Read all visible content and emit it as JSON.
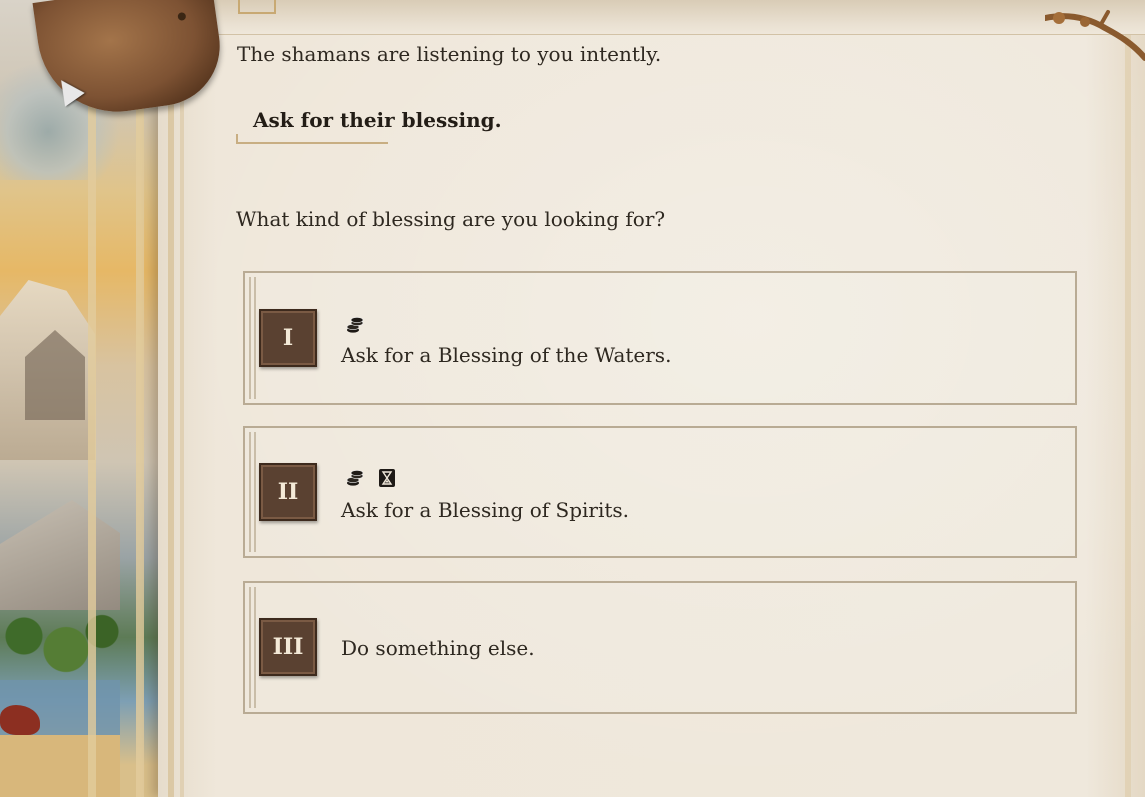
{
  "dialog": {
    "intro_text": "The shamans are listening to you intently.",
    "previous_choice": "Ask for their blessing.",
    "question": "What kind of blessing are you looking for?"
  },
  "options": [
    {
      "numeral": "I",
      "icons": [
        "coins-icon"
      ],
      "text": "Ask for a Blessing of the Waters."
    },
    {
      "numeral": "II",
      "icons": [
        "coins-icon",
        "hourglass-icon"
      ],
      "text": "Ask for a Blessing of Spirits."
    },
    {
      "numeral": "III",
      "icons": [],
      "text": "Do something else."
    }
  ],
  "colors": {
    "parchment": "#efe7da",
    "text": "#2e2820",
    "numeral_bg": "#5a4131",
    "card_border": "#b9ab94",
    "leather": "#7d5233"
  }
}
